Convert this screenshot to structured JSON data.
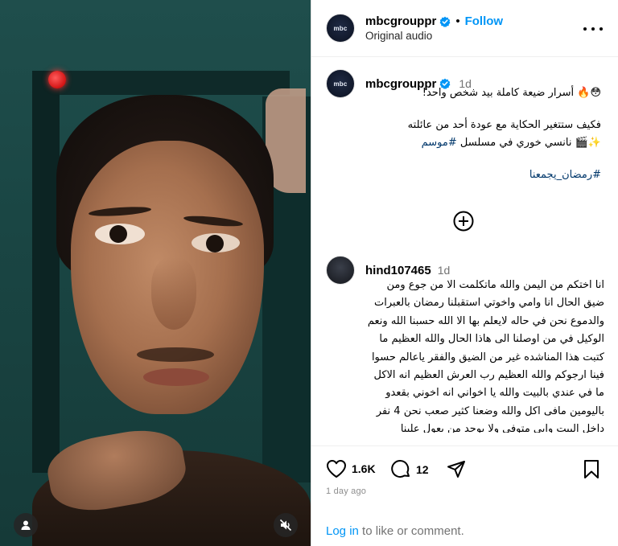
{
  "header": {
    "username": "mbcgrouppr",
    "separator": "•",
    "follow_label": "Follow",
    "audio_label": "Original audio",
    "avatar_text": "mbc"
  },
  "caption": {
    "username": "mbcgrouppr",
    "time": "1d",
    "line1": "😳🔥 أسرار ضيعة كاملة بيد شخص واحد!",
    "line2": "فكيف ستتغير الحكاية مع عودة أحد من عائلته",
    "line3_text": "✨🎬 نانسي خوري في مسلسل ",
    "line3_tag": "#موسم",
    "line4": "#رمضان_يجمعنا"
  },
  "comment": {
    "username": "hind107465",
    "time": "1d",
    "text": "انا اختكم من اليمن والله ماتكلمت الا من جوع ومن ضيق الحال انا وامي واخوتي استقبلنا رمضان بالعبرات والدموع نحن في حاله لايعلم بها الا الله حسبنا الله ونعم الوكيل في من اوصلنا الى هاذا الحال والله العظيم ما كتبت هذا المناشده غير من الضيق والفقر ياعالم حسوا فينا ارجوكم والله العظيم رب العرش العظيم انه الاكل ما في عندي بالبيت والله يا اخواني انه اخوني بقعدو باليومين مافى اكل والله وضعنا كثير صعب نحن 4 نفر داخل البيت وابي متوفي ولا يوجد من يعول علينا وساكنين في بيت اجار لانستطيع دفع الاجار صاحب البيت اعطانا مهله اسبوع اذا ما دفعنا راح يطردنا"
  },
  "actions": {
    "likes": "1.6K",
    "comments": "12",
    "posted_ago": "1 day ago"
  },
  "login": {
    "link_label": "Log in",
    "rest": " to like or comment."
  },
  "colors": {
    "accent": "#0095f6",
    "hashtag": "#00376b",
    "muted": "#737373"
  },
  "icons": [
    "verified-badge-icon",
    "more-options-icon",
    "add-comment-icon",
    "heart-icon",
    "comment-icon",
    "share-icon",
    "bookmark-icon",
    "user-tag-icon",
    "mute-icon"
  ]
}
